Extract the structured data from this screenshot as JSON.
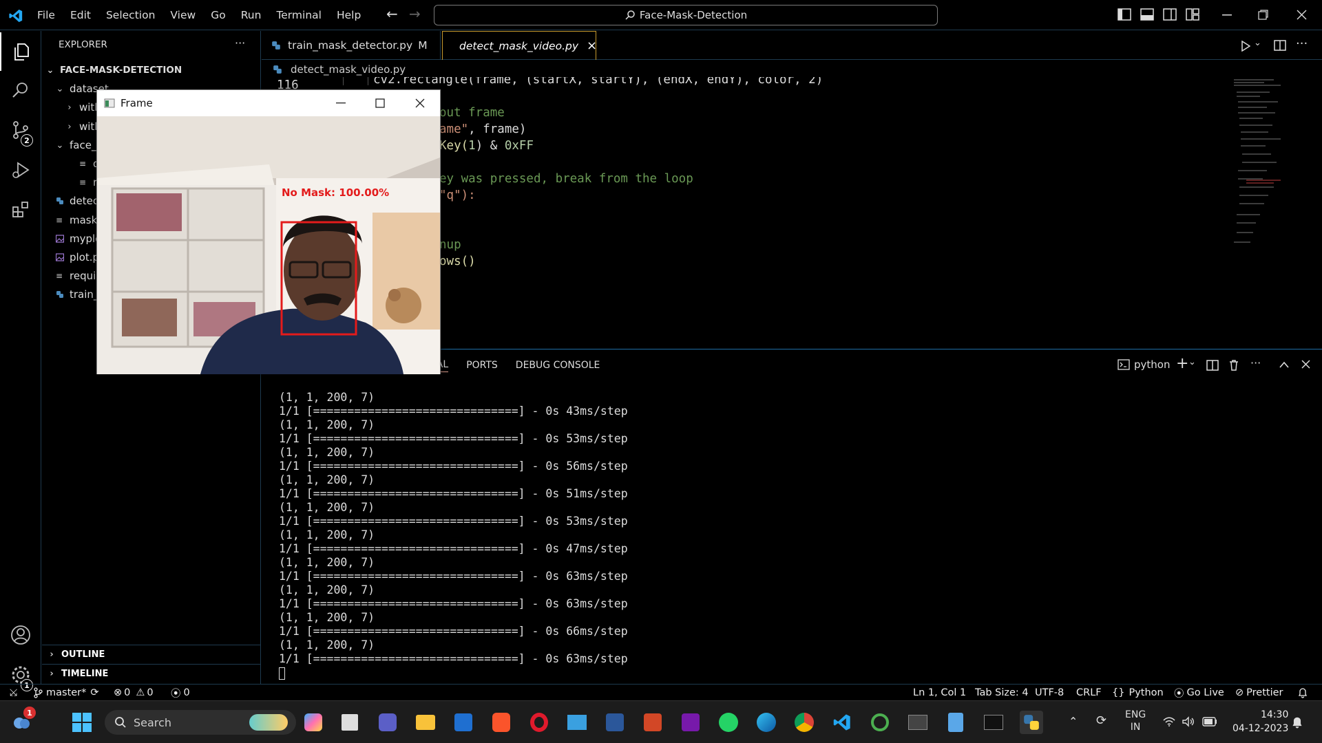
{
  "titlebar": {
    "menu": [
      "File",
      "Edit",
      "Selection",
      "View",
      "Go",
      "Run",
      "Terminal",
      "Help"
    ],
    "search": "Face-Mask-Detection"
  },
  "activity": {
    "scm_badge": "2",
    "settings_badge": "1"
  },
  "sidebar": {
    "title": "EXPLORER",
    "more": "···",
    "root": "FACE-MASK-DETECTION",
    "items": [
      "dataset",
      "with",
      "with",
      "face_",
      "dep",
      "res1",
      "detec",
      "mask",
      "myplo",
      "plot.p",
      "requi",
      "train_"
    ],
    "outline": "OUTLINE",
    "timeline": "TIMELINE"
  },
  "tabs": [
    {
      "label": "train_mask_detector.py",
      "status": "M"
    },
    {
      "label": "detect_mask_video.py",
      "status": "×"
    }
  ],
  "breadcrumb": "detect_mask_video.py",
  "code": {
    "line_number": "116",
    "l116": "cv2.rectangle(frame, (startX, startY), (endX, endY), color, 2)",
    "l118": "out frame",
    "l119a": "ame\"",
    "l119b": ", frame)",
    "l120a": "Key(",
    "l120b": "1",
    "l120c": ") & ",
    "l120d": "0xFF",
    "l122": "ey was pressed, break from the loop",
    "l123": "\"q\"):",
    "l126": "nup",
    "l127": "ows()"
  },
  "panel": {
    "tabs": [
      "TERMINAL",
      "PORTS",
      "DEBUG CONSOLE"
    ],
    "terminal_name": "python",
    "lines": [
      "(1, 1, 200, 7)",
      "1/1 [==============================] - 0s 43ms/step",
      "(1, 1, 200, 7)",
      "1/1 [==============================] - 0s 53ms/step",
      "(1, 1, 200, 7)",
      "1/1 [==============================] - 0s 56ms/step",
      "(1, 1, 200, 7)",
      "1/1 [==============================] - 0s 51ms/step",
      "(1, 1, 200, 7)",
      "1/1 [==============================] - 0s 53ms/step",
      "(1, 1, 200, 7)",
      "1/1 [==============================] - 0s 47ms/step",
      "(1, 1, 200, 7)",
      "1/1 [==============================] - 0s 63ms/step",
      "(1, 1, 200, 7)",
      "1/1 [==============================] - 0s 63ms/step",
      "(1, 1, 200, 7)",
      "1/1 [==============================] - 0s 66ms/step",
      "(1, 1, 200, 7)",
      "1/1 [==============================] - 0s 63ms/step"
    ]
  },
  "frame_window": {
    "title": "Frame",
    "label": "No Mask: 100.00%"
  },
  "statusbar": {
    "branch": "master*",
    "errors": "0",
    "warnings": "0",
    "ports": "0",
    "position": "Ln 1, Col 1",
    "tab_size": "Tab Size: 4",
    "encoding": "UTF-8",
    "eol": "CRLF",
    "language": "Python",
    "golive": "Go Live",
    "prettier": "Prettier"
  },
  "taskbar": {
    "search": "Search",
    "notif": "1",
    "lang1": "ENG",
    "lang2": "IN",
    "time": "14:30",
    "date": "04-12-2023"
  },
  "colors": {
    "accent": "#1e6fa7",
    "error_red": "#e31b1b",
    "tab_highlight": "#c79a2e"
  }
}
